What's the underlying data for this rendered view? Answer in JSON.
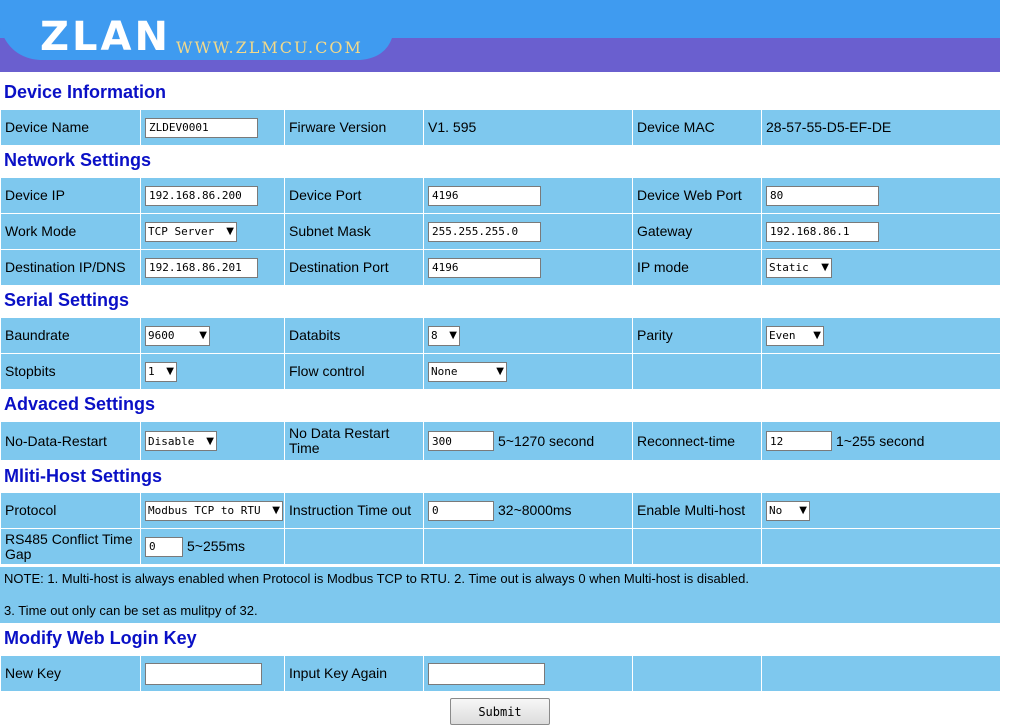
{
  "banner": {
    "logo": "ZLAN",
    "url": "WWW.ZLMCU.COM"
  },
  "sections": {
    "device_info": "Device Information",
    "network": "Network Settings",
    "serial": "Serial Settings",
    "advanced": "Advaced Settings",
    "multihost": "Mliti-Host Settings",
    "login": "Modify Web Login Key"
  },
  "device_info": {
    "device_name_label": "Device Name",
    "device_name_value": "ZLDEV0001",
    "firmware_label": "Firware Version",
    "firmware_value": "V1. 595",
    "mac_label": "Device MAC",
    "mac_value": "28-57-55-D5-EF-DE"
  },
  "network": {
    "device_ip_label": "Device IP",
    "device_ip_value": "192.168.86.200",
    "device_port_label": "Device Port",
    "device_port_value": "4196",
    "web_port_label": "Device Web Port",
    "web_port_value": "80",
    "work_mode_label": "Work Mode",
    "work_mode_value": "TCP Server",
    "subnet_label": "Subnet Mask",
    "subnet_value": "255.255.255.0",
    "gateway_label": "Gateway",
    "gateway_value": "192.168.86.1",
    "dest_ip_label": "Destination IP/DNS",
    "dest_ip_value": "192.168.86.201",
    "dest_port_label": "Destination Port",
    "dest_port_value": "4196",
    "ip_mode_label": "IP mode",
    "ip_mode_value": "Static"
  },
  "serial": {
    "baud_label": "Baundrate",
    "baud_value": "9600",
    "databits_label": "Databits",
    "databits_value": "8",
    "parity_label": "Parity",
    "parity_value": "Even",
    "stopbits_label": "Stopbits",
    "stopbits_value": "1",
    "flow_label": "Flow control",
    "flow_value": "None"
  },
  "advanced": {
    "no_data_restart_label": "No-Data-Restart",
    "no_data_restart_value": "Disable",
    "restart_time_label": "No Data Restart Time",
    "restart_time_value": "300",
    "restart_time_unit": "5~1270 second",
    "reconnect_label": "Reconnect-time",
    "reconnect_value": "12",
    "reconnect_unit": "1~255 second"
  },
  "multihost": {
    "protocol_label": "Protocol",
    "protocol_value": "Modbus TCP to RTU",
    "timeout_label": "Instruction Time out",
    "timeout_value": "0",
    "timeout_unit": "32~8000ms",
    "enable_label": "Enable Multi-host",
    "enable_value": "No",
    "rs485_label": "RS485 Conflict Time Gap",
    "rs485_value": "0",
    "rs485_unit": "5~255ms",
    "note_line1": "NOTE: 1. Multi-host is always enabled when Protocol is Modbus TCP to RTU. 2. Time out is always 0 when Multi-host is disabled.",
    "note_line2": "3. Time out only can be set as mulitpy of 32."
  },
  "login": {
    "new_key_label": "New Key",
    "new_key_value": "",
    "again_label": "Input Key Again",
    "again_value": ""
  },
  "submit_label": "Submit",
  "colors": {
    "banner_blue": "#3f9bf0",
    "banner_purple": "#6a5fcf",
    "row_bg": "#7ec8ee",
    "section_title": "#0a10c6"
  }
}
